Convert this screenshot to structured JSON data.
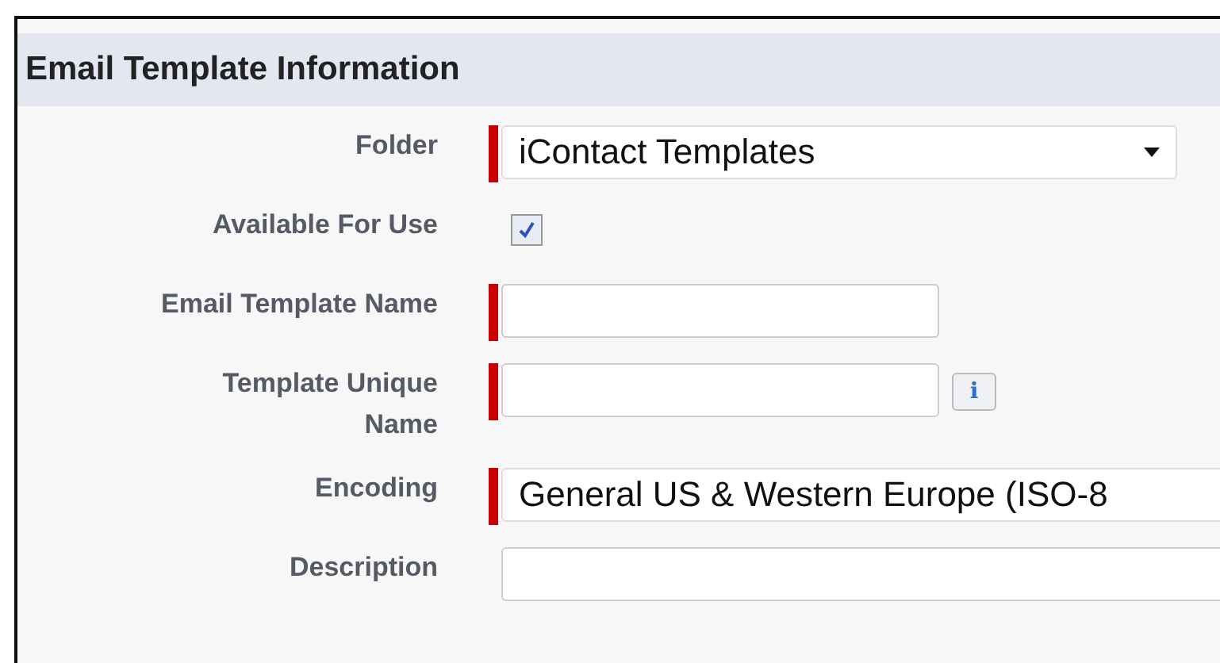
{
  "section": {
    "title": "Email Template Information"
  },
  "fields": [
    {
      "kind": "select",
      "label": "Folder",
      "required": true,
      "value": "iContact Templates",
      "wide": false
    },
    {
      "kind": "checkbox",
      "label": "Available For Use",
      "required": false,
      "checked": true
    },
    {
      "kind": "text",
      "label": "Email Template Name",
      "required": true
    },
    {
      "kind": "text",
      "label": "Template Unique Name",
      "required": true,
      "info": "i"
    },
    {
      "kind": "select",
      "label": "Encoding",
      "required": true,
      "value": "General US & Western Europe (ISO-8",
      "wide": true
    },
    {
      "kind": "text",
      "label": "Description",
      "required": false,
      "wide": true
    }
  ]
}
